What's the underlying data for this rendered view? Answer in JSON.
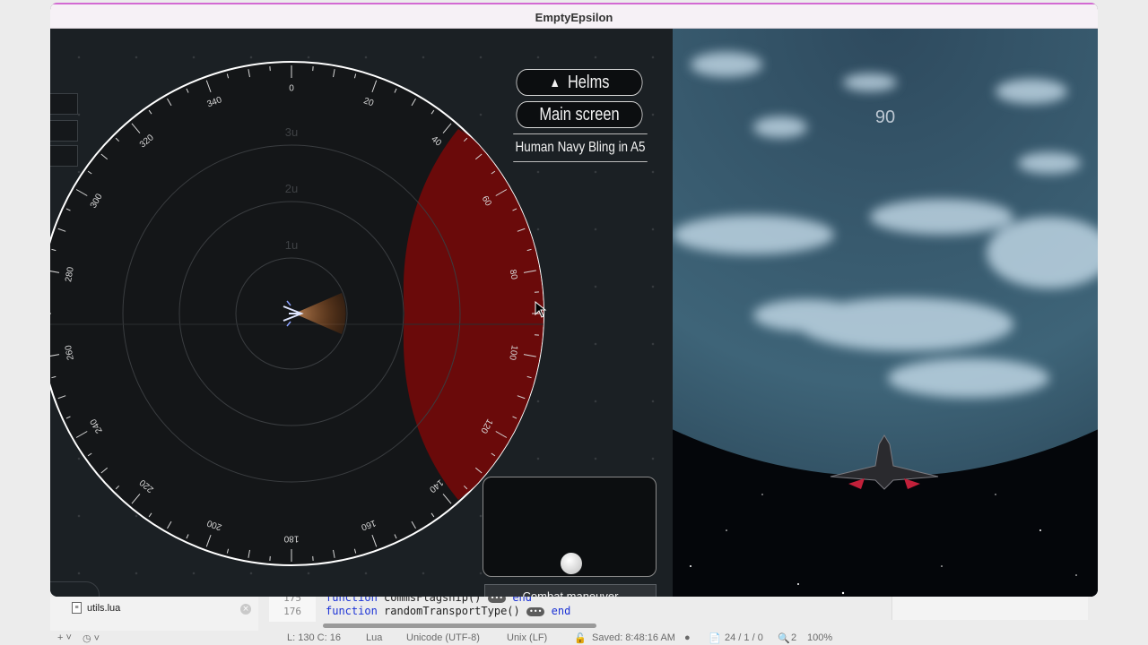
{
  "window": {
    "title": "EmptyEpsilon"
  },
  "helms": {
    "station_label": "Helms",
    "mainscreen_label": "Main screen",
    "ship_name": "Human Navy Bling in A5",
    "combat_label": "Combat maneuver",
    "heading": "90"
  },
  "radar": {
    "ring_labels": [
      "3u",
      "2u",
      "1u"
    ],
    "bearings": [
      "0",
      "20",
      "40",
      "60",
      "80",
      "100",
      "120",
      "140",
      "160",
      "180",
      "200",
      "220",
      "240",
      "260",
      "280",
      "300",
      "320",
      "340"
    ]
  },
  "editor": {
    "file_name": "utils.lua",
    "lines": [
      {
        "num": "175",
        "keyword": "function",
        "text": "commsFlagship()",
        "end": "end"
      },
      {
        "num": "176",
        "keyword": "function",
        "text": "randomTransportType()",
        "end": "end"
      }
    ],
    "status": {
      "position": "L: 130 C: 16",
      "language": "Lua",
      "encoding": "Unicode (UTF-8)",
      "line_endings": "Unix (LF)",
      "saved": "Saved: 8:48:16 AM",
      "counts": "24 / 1 / 0",
      "zoom_count": "2",
      "zoom": "100%"
    }
  },
  "colors": {
    "arc_red": "#6a0a0a",
    "title_accent": "#d36ad3",
    "background": "#1b2024"
  }
}
